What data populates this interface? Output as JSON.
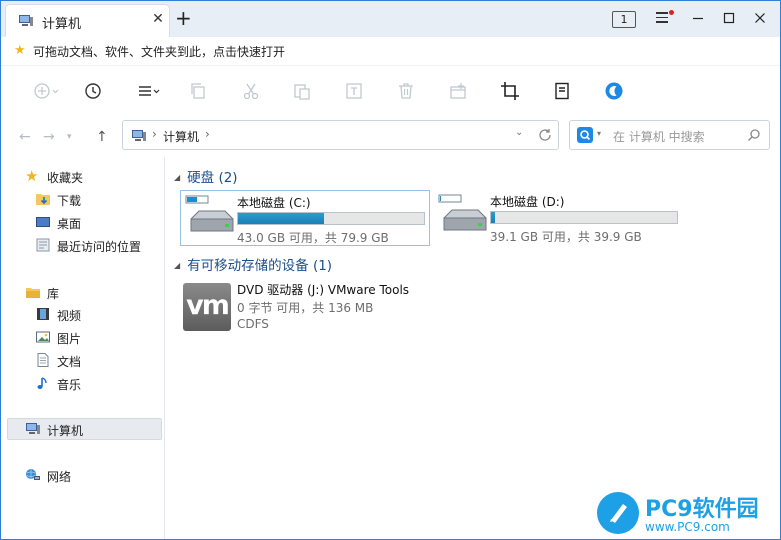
{
  "tab": {
    "label": "计算机",
    "close_glyph": "✕",
    "new_glyph": "+",
    "count": "1"
  },
  "quick_access": {
    "text": "可拖动文档、软件、文件夹到此，点击快速打开"
  },
  "address": {
    "location": "计算机",
    "separator": "›",
    "dropdown_glyph": "⌄"
  },
  "search": {
    "placeholder": "在 计算机 中搜索"
  },
  "navigation": {
    "back": "←",
    "forward": "→",
    "up": "↑"
  },
  "sidebar": {
    "favorites": {
      "label": "收藏夹",
      "items": [
        "下载",
        "桌面",
        "最近访问的位置"
      ]
    },
    "libraries": {
      "label": "库",
      "items": [
        "视频",
        "图片",
        "文档",
        "音乐"
      ]
    },
    "computer": "计算机",
    "network": "网络"
  },
  "groups": {
    "hard_drives": {
      "title": "硬盘 (2)",
      "drives": [
        {
          "name": "本地磁盘 (C:)",
          "info": "43.0 GB 可用，共 79.9 GB",
          "used_fraction": 0.462
        },
        {
          "name": "本地磁盘 (D:)",
          "info": "39.1 GB 可用，共 39.9 GB",
          "used_fraction": 0.02
        }
      ]
    },
    "removable": {
      "title": "有可移动存储的设备 (1)",
      "dvd": {
        "icon_text": "vm",
        "name": "DVD 驱动器 (J:) VMware Tools",
        "info": "0 字节 可用，共 136 MB",
        "filesystem": "CDFS"
      }
    }
  },
  "watermark": {
    "brand": "PC9软件园",
    "url": "www.PC9.com"
  },
  "colors": {
    "accent": "#1e88e5",
    "drive_bar": "#1b8fc9",
    "group_title": "#1b4f8c",
    "window_border": "#2f7fd6"
  }
}
